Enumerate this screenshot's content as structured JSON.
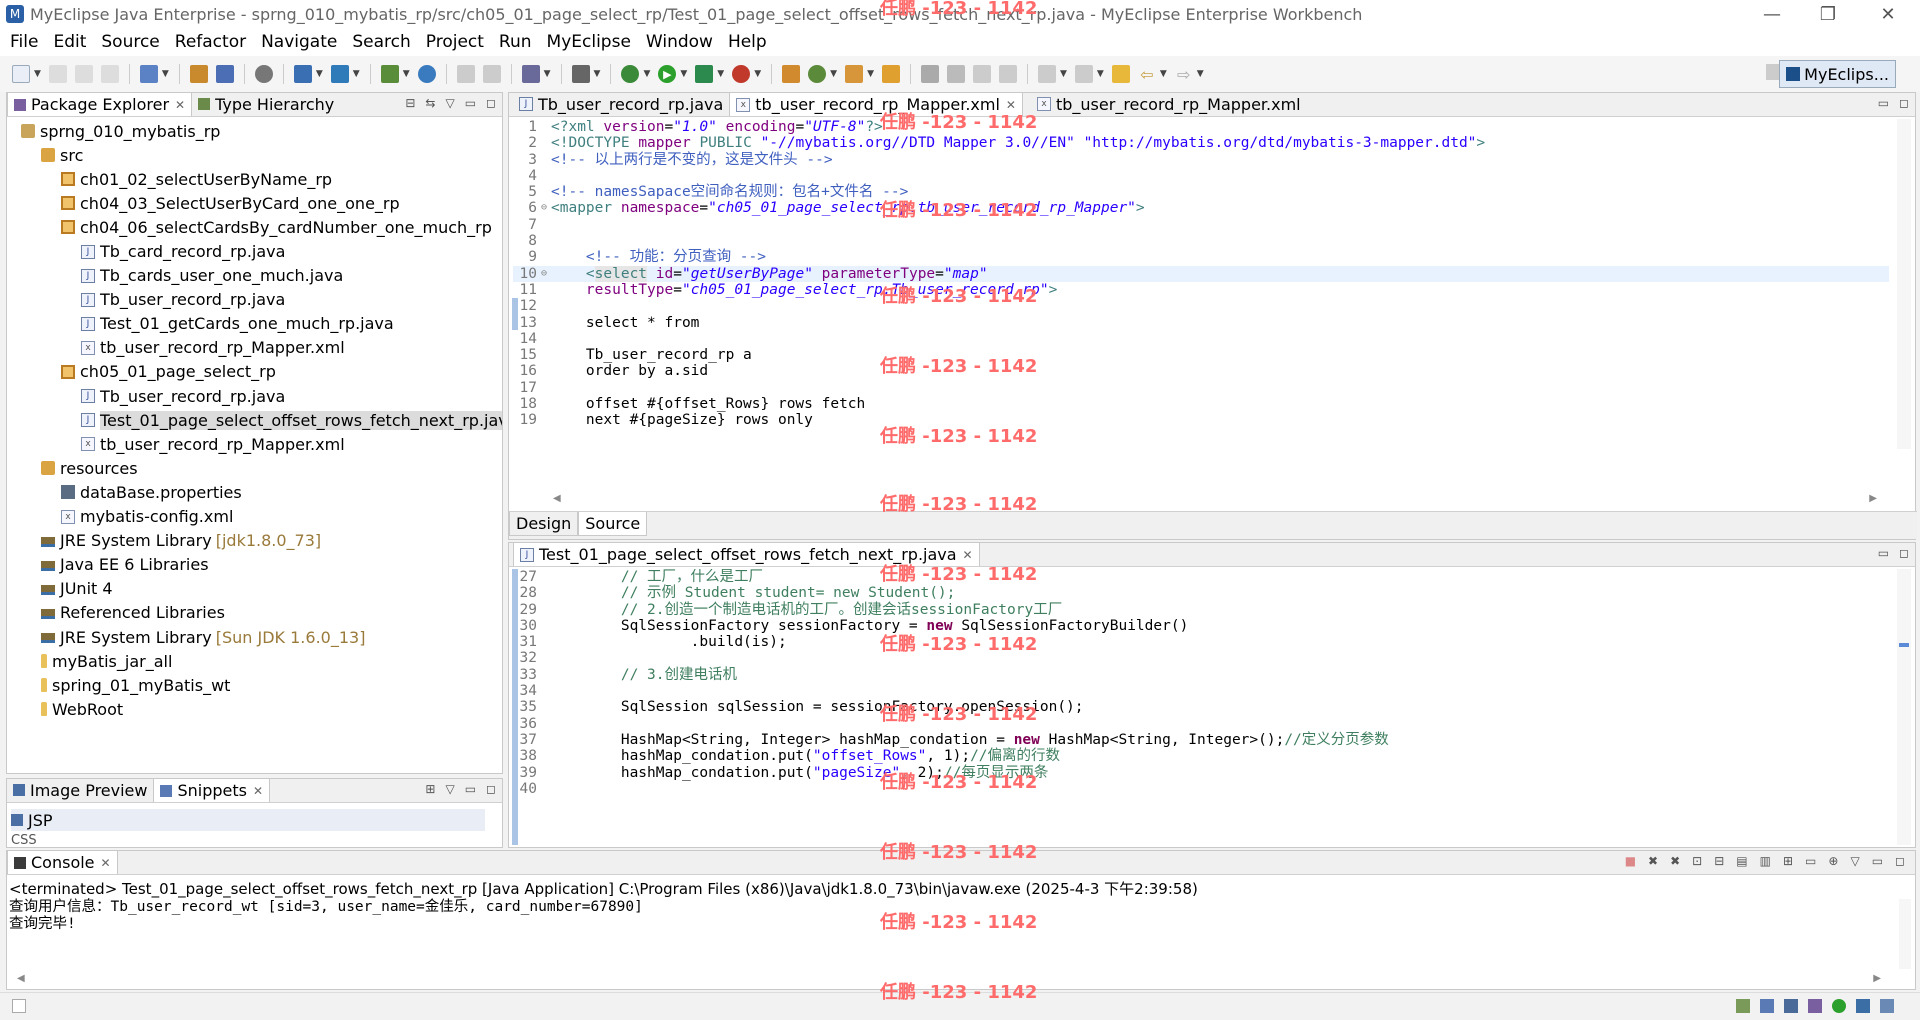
{
  "window": {
    "title": "MyEclipse Java Enterprise - sprng_010_mybatis_rp/src/ch05_01_page_select_rp/Test_01_page_select_offset_rows_fetch_next_rp.java - MyEclipse Enterprise Workbench",
    "minimize": "—",
    "restore": "❐",
    "close": "✕"
  },
  "menu": [
    "File",
    "Edit",
    "Source",
    "Refactor",
    "Navigate",
    "Search",
    "Project",
    "Run",
    "MyEclipse",
    "Window",
    "Help"
  ],
  "perspective": {
    "label": "MyEclips..."
  },
  "package_explorer": {
    "tabs": [
      {
        "label": "Package Explorer"
      },
      {
        "label": "Type Hierarchy"
      }
    ],
    "tree": [
      {
        "indent": 0,
        "icon": "proj",
        "label": "sprng_010_mybatis_rp",
        "extra": ""
      },
      {
        "indent": 1,
        "icon": "srcf",
        "label": "src",
        "extra": ""
      },
      {
        "indent": 2,
        "icon": "pkg",
        "label": "ch01_02_selectUserByName_rp",
        "extra": ""
      },
      {
        "indent": 2,
        "icon": "pkg",
        "label": "ch04_03_SelectUserByCard_one_one_rp",
        "extra": ""
      },
      {
        "indent": 2,
        "icon": "pkg",
        "label": "ch04_06_selectCardsBy_cardNumber_one_much_rp",
        "extra": ""
      },
      {
        "indent": 3,
        "icon": "java",
        "label": "Tb_card_record_rp.java",
        "extra": ""
      },
      {
        "indent": 3,
        "icon": "java",
        "label": "Tb_cards_user_one_much.java",
        "extra": ""
      },
      {
        "indent": 3,
        "icon": "java",
        "label": "Tb_user_record_rp.java",
        "extra": ""
      },
      {
        "indent": 3,
        "icon": "java",
        "label": "Test_01_getCards_one_much_rp.java",
        "extra": ""
      },
      {
        "indent": 3,
        "icon": "xml",
        "label": "tb_user_record_rp_Mapper.xml",
        "extra": ""
      },
      {
        "indent": 2,
        "icon": "pkg",
        "label": "ch05_01_page_select_rp",
        "extra": ""
      },
      {
        "indent": 3,
        "icon": "java",
        "label": "Tb_user_record_rp.java",
        "extra": ""
      },
      {
        "indent": 3,
        "icon": "java",
        "label": "Test_01_page_select_offset_rows_fetch_next_rp.java",
        "extra": "",
        "selected": true
      },
      {
        "indent": 3,
        "icon": "xml",
        "label": "tb_user_record_rp_Mapper.xml",
        "extra": ""
      },
      {
        "indent": 1,
        "icon": "srcf",
        "label": "resources",
        "extra": ""
      },
      {
        "indent": 2,
        "icon": "props",
        "label": "dataBase.properties",
        "extra": ""
      },
      {
        "indent": 2,
        "icon": "xml",
        "label": "mybatis-config.xml",
        "extra": ""
      },
      {
        "indent": 1,
        "icon": "lib",
        "label": "JRE System Library",
        "extra": "[jdk1.8.0_73]"
      },
      {
        "indent": 1,
        "icon": "lib",
        "label": "Java EE 6 Libraries",
        "extra": ""
      },
      {
        "indent": 1,
        "icon": "lib",
        "label": "JUnit 4",
        "extra": ""
      },
      {
        "indent": 1,
        "icon": "lib",
        "label": "Referenced Libraries",
        "extra": ""
      },
      {
        "indent": 1,
        "icon": "lib",
        "label": "JRE System Library",
        "extra": "[Sun JDK 1.6.0_13]"
      },
      {
        "indent": 1,
        "icon": "fold",
        "label": "myBatis_jar_all",
        "extra": ""
      },
      {
        "indent": 1,
        "icon": "fold",
        "label": "spring_01_myBatis_wt",
        "extra": ""
      },
      {
        "indent": 1,
        "icon": "fold",
        "label": "WebRoot",
        "extra": ""
      }
    ]
  },
  "snippets": {
    "tabs": [
      {
        "label": "Image Preview"
      },
      {
        "label": "Snippets"
      }
    ],
    "items": [
      "JSP",
      "CSS"
    ]
  },
  "xml_editor": {
    "tabs": [
      {
        "label": "Tb_user_record_rp.java"
      },
      {
        "label": "tb_user_record_rp_Mapper.xml"
      },
      {
        "label": "tb_user_record_rp_Mapper.xml"
      }
    ],
    "bottom_tabs": [
      "Design",
      "Source"
    ],
    "lines": [
      {
        "n": "1",
        "fold": "",
        "html": "<span class='xmltag'>&lt;?xml</span> <span class='xmlattr'>version</span>=<span class='xmlval'>\"1.0\"</span> <span class='xmlattr'>encoding</span>=<span class='xmlval'>\"UTF-8\"</span><span class='xmltag'>?&gt;</span>"
      },
      {
        "n": "2",
        "fold": "",
        "html": "<span class='xmltag'>&lt;!DOCTYPE</span> <span class='xmlattr'>mapper</span> <span class='xmltag'>PUBLIC</span> <span class='xmlval' style='font-style:normal'>\"-//mybatis.org//DTD Mapper 3.0//EN\"</span> <span class='xmlval' style='font-style:normal'>\"http://mybatis.org/dtd/mybatis-3-mapper.dtd\"</span><span class='xmltag'>&gt;</span>"
      },
      {
        "n": "3",
        "fold": "",
        "html": "<span class='xmlcmt'>&lt;!-- 以上两行是不变的，这是文件头 --&gt;</span>"
      },
      {
        "n": "4",
        "fold": "",
        "html": ""
      },
      {
        "n": "5",
        "fold": "",
        "html": "<span class='xmlcmt'>&lt;!-- namesSapace空间命名规则：包名+文件名 --&gt;</span>"
      },
      {
        "n": "6",
        "fold": "⊖",
        "html": "<span class='xmltag'>&lt;mapper</span> <span class='xmlattr'>namespace</span>=<span class='xmlval'>\"ch05_01_page_select_rp.tb_user_record_rp_Mapper\"</span><span class='xmltag'>&gt;</span>"
      },
      {
        "n": "7",
        "fold": "",
        "html": ""
      },
      {
        "n": "8",
        "fold": "",
        "html": ""
      },
      {
        "n": "9",
        "fold": "",
        "html": "    <span class='xmlcmt'>&lt;!-- 功能：分页查询 --&gt;</span>"
      },
      {
        "n": "10",
        "fold": "⊖",
        "html": "    <span class='xmltag'>&lt;</span><span class='xmltag' style='background:#e6e6e6'>select</span> <span class='xmlattr'>id</span>=<span class='xmlval'>\"getUserByPage\"</span> <span class='xmlattr'>parameterType</span>=<span class='xmlval'>\"map\"</span>",
        "hl": true
      },
      {
        "n": "11",
        "fold": "",
        "html": "    <span class='xmlattr'>resultType</span>=<span class='xmlval'>\"ch05_01_page_select_rp.Tb_user_record_rp\"</span><span class='xmltag'>&gt;</span>"
      },
      {
        "n": "12",
        "fold": "",
        "html": ""
      },
      {
        "n": "13",
        "fold": "",
        "html": "    select * from"
      },
      {
        "n": "14",
        "fold": "",
        "html": ""
      },
      {
        "n": "15",
        "fold": "",
        "html": "    Tb_user_record_rp a"
      },
      {
        "n": "16",
        "fold": "",
        "html": "    order by a.sid"
      },
      {
        "n": "17",
        "fold": "",
        "html": ""
      },
      {
        "n": "18",
        "fold": "",
        "html": "    offset #{offset_Rows} rows fetch"
      },
      {
        "n": "19",
        "fold": "",
        "html": "    next #{pageSize} rows only"
      }
    ]
  },
  "java_editor": {
    "tab": {
      "label": "Test_01_page_select_offset_rows_fetch_next_rp.java"
    },
    "lines": [
      {
        "n": "27",
        "html": "        <span class='jcmt'>// 工厂，什么是工厂</span>"
      },
      {
        "n": "28",
        "html": "        <span class='jcmt'>// 示例 Student student= new Student();</span>"
      },
      {
        "n": "29",
        "html": "        <span class='jcmt'>// 2.创造一个制造电话机的工厂。创建会话sessionFactory工厂</span>"
      },
      {
        "n": "30",
        "html": "        SqlSessionFactory sessionFactory = <span class='jkw'>new</span> SqlSessionFactoryBuilder()"
      },
      {
        "n": "31",
        "html": "                .build(is);"
      },
      {
        "n": "32",
        "html": ""
      },
      {
        "n": "33",
        "html": "        <span class='jcmt'>// 3.创建电话机</span>"
      },
      {
        "n": "34",
        "html": ""
      },
      {
        "n": "35",
        "html": "        SqlSession sqlSession = sessionFactory.openSession();"
      },
      {
        "n": "36",
        "html": ""
      },
      {
        "n": "37",
        "html": "        HashMap&lt;String, Integer&gt; hashMap_condation = <span class='jkw'>new</span> HashMap&lt;String, Integer&gt;();<span class='jcmt'>//定义分页参数</span>"
      },
      {
        "n": "38",
        "html": "        hashMap_condation.put(<span class='jstr'>\"offset_Rows\"</span>, 1);<span class='jcmt'>//偏离的行数</span>"
      },
      {
        "n": "39",
        "html": "        hashMap_condation.put(<span class='jstr'>\"pageSize\"</span>, 2);<span class='jcmt'>//每页显示两条</span>"
      },
      {
        "n": "40",
        "html": ""
      }
    ]
  },
  "console": {
    "tab": {
      "label": "Console"
    },
    "header": "<terminated> Test_01_page_select_offset_rows_fetch_next_rp [Java Application] C:\\Program Files (x86)\\Java\\jdk1.8.0_73\\bin\\javaw.exe (2025-4-3 下午2:39:58)",
    "output": [
      "查询用户信息：Tb_user_record_wt [sid=3, user_name=金佳乐, card_number=67890]",
      "查询完毕!"
    ]
  },
  "watermark": "任鹏 -123 - 1142"
}
